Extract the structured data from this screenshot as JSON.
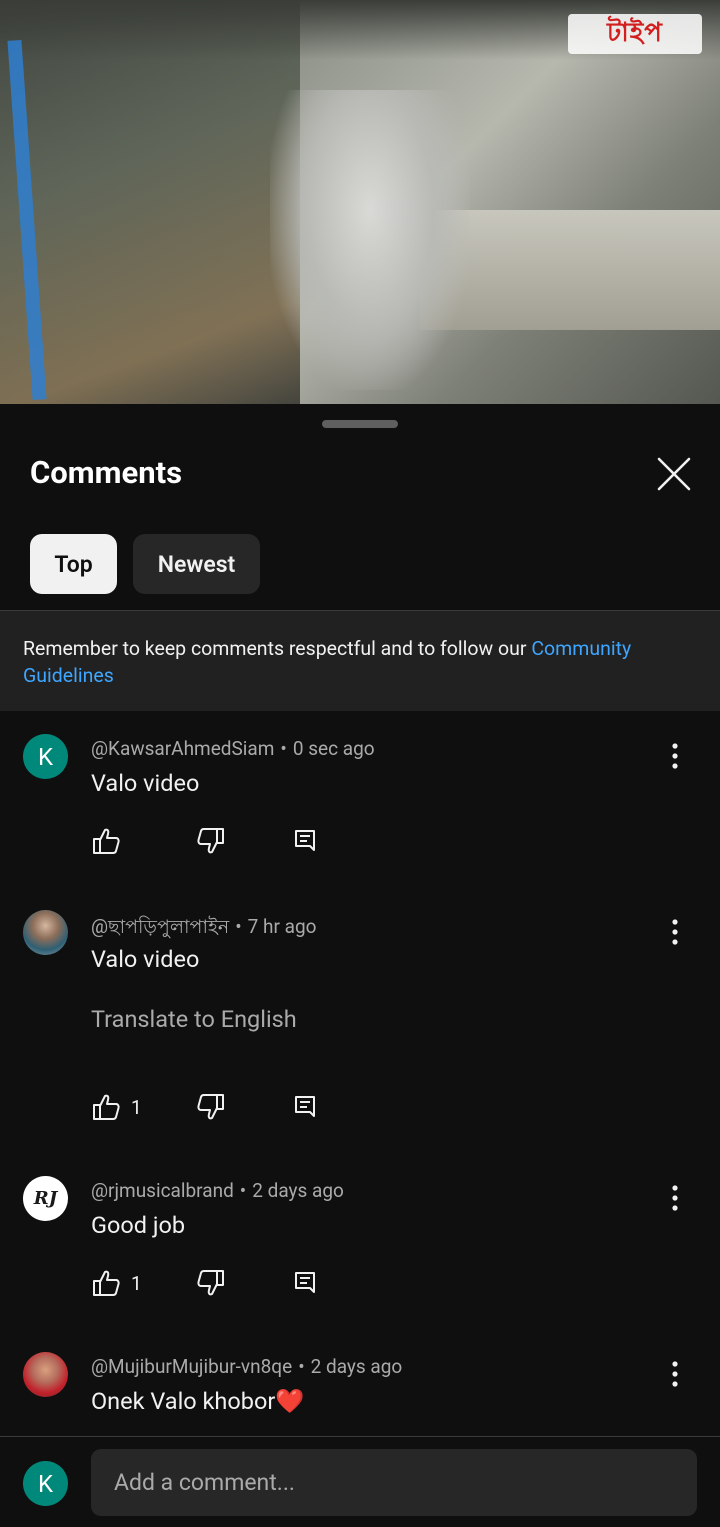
{
  "video": {
    "logo_text": "টাইপ"
  },
  "panel": {
    "title": "Comments",
    "close_icon": "close-icon",
    "sort_tabs": [
      {
        "label": "Top",
        "selected": true
      },
      {
        "label": "Newest",
        "selected": false
      }
    ],
    "notice_text": "Remember to keep comments respectful and to follow our ",
    "notice_link": "Community Guidelines"
  },
  "comments": [
    {
      "avatar_letter": "K",
      "author": "@KawsarAhmedSiam",
      "time": "0 sec ago",
      "text": "Valo video",
      "likes": "",
      "translate": ""
    },
    {
      "avatar_letter": "",
      "author": "@ছাপড়িপুলাপাইন",
      "time": "7 hr ago",
      "text": "Valo video",
      "likes": "1",
      "translate": "Translate to English"
    },
    {
      "avatar_letter": "RJ",
      "author": "@rjmusicalbrand",
      "time": "2 days ago",
      "text": "Good job",
      "likes": "1",
      "translate": ""
    },
    {
      "avatar_letter": "",
      "author": "@MujiburMujibur-vn8qe",
      "time": "2 days ago",
      "text": "Onek Valo khobor❤️",
      "likes": "",
      "translate": ""
    }
  ],
  "composer": {
    "avatar_letter": "K",
    "placeholder": "Add a comment..."
  },
  "colors": {
    "background": "#0f0f0f",
    "link": "#3ea6ff",
    "avatar_k": "#00897b",
    "chip_selected": "#f1f1f1",
    "chip_default": "#272727"
  }
}
